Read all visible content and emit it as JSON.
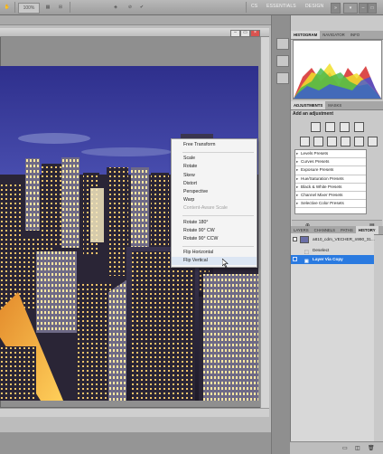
{
  "options_bar": {
    "zoom": "100%",
    "workspaces": [
      "CS",
      "ESSENTIALS",
      "DESIGN"
    ]
  },
  "context_menu": {
    "groups": [
      [
        {
          "label": "Free Transform",
          "enabled": true
        }
      ],
      [
        {
          "label": "Scale",
          "enabled": true
        },
        {
          "label": "Rotate",
          "enabled": true
        },
        {
          "label": "Skew",
          "enabled": true
        },
        {
          "label": "Distort",
          "enabled": true
        },
        {
          "label": "Perspective",
          "enabled": true
        },
        {
          "label": "Warp",
          "enabled": true
        },
        {
          "label": "Content-Aware Scale",
          "enabled": false
        }
      ],
      [
        {
          "label": "Rotate 180°",
          "enabled": true
        },
        {
          "label": "Rotate 90° CW",
          "enabled": true
        },
        {
          "label": "Rotate 90° CCW",
          "enabled": true
        }
      ],
      [
        {
          "label": "Flip Horizontal",
          "enabled": true
        },
        {
          "label": "Flip Vertical",
          "enabled": true,
          "hovered": true
        }
      ]
    ]
  },
  "panels": {
    "top_tabs": [
      "HISTOGRAM",
      "NAVIGATOR",
      "INFO"
    ],
    "mid_tabs": [
      "ADJUSTMENTS",
      "MASKS"
    ],
    "add_adjustment": "Add an adjustment",
    "presets": [
      "Levels Presets",
      "Curves Presets",
      "Exposure Presets",
      "Hue/Saturation Presets",
      "Black & White Presets",
      "Channel Mixer Presets",
      "Selective Color Presets"
    ],
    "bottom_tabs": [
      "LAYERS",
      "CHANNELS",
      "PATHS",
      "HISTORY"
    ],
    "history": [
      {
        "label": "a810_cdm_VECHER_n990_31...",
        "type": "snapshot"
      },
      {
        "label": "Deselect",
        "type": "step"
      },
      {
        "label": "Layer Via Copy",
        "type": "step",
        "active": true
      }
    ]
  },
  "colors": {
    "accent": "#2a7ae0",
    "sky_top": "#3b3f9a",
    "sky_bottom": "#7a86c9"
  }
}
